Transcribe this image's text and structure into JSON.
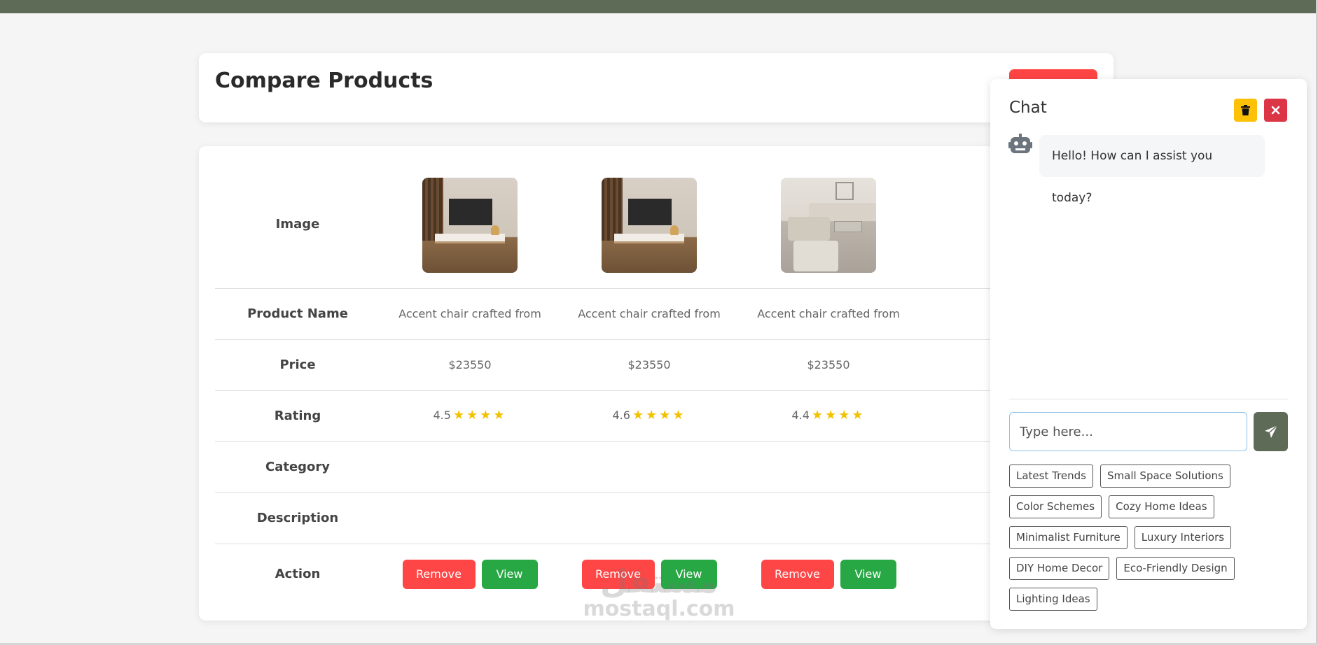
{
  "page": {
    "title": "Compare Products"
  },
  "compare": {
    "row_labels": {
      "image": "Image",
      "name": "Product Name",
      "price": "Price",
      "rating": "Rating",
      "category": "Category",
      "description": "Description",
      "action": "Action"
    },
    "products": [
      {
        "image": "tv-unit-photo",
        "name": "Accent chair crafted from",
        "price": "$23550",
        "rating": "4.5",
        "stars": "★★★★",
        "category": "",
        "description": "",
        "remove_label": "Remove",
        "view_label": "View"
      },
      {
        "image": "tv-unit-photo",
        "name": "Accent chair crafted from",
        "price": "$23550",
        "rating": "4.6",
        "stars": "★★★★",
        "category": "",
        "description": "",
        "remove_label": "Remove",
        "view_label": "View"
      },
      {
        "image": "sofa-living-room-photo",
        "name": "Accent chair crafted from",
        "price": "$23550",
        "rating": "4.4",
        "stars": "★★★★",
        "category": "",
        "description": "",
        "remove_label": "Remove",
        "view_label": "View"
      }
    ]
  },
  "chat": {
    "title": "Chat",
    "trash_icon": "trash-icon",
    "close_icon": "close-icon",
    "bot_icon": "robot-icon",
    "messages": [
      {
        "from": "bot",
        "text": "Hello! How can I assist you today?"
      }
    ],
    "input_placeholder": "Type here...",
    "send_icon": "paper-plane-icon",
    "suggestions": [
      "Latest Trends",
      "Small Space Solutions",
      "Color Schemes",
      "Cozy Home Ideas",
      "Minimalist Furniture",
      "Luxury Interiors",
      "DIY Home Decor",
      "Eco-Friendly Design",
      "Lighting Ideas"
    ]
  },
  "watermark": {
    "arabic": "مستقل",
    "latin": "mostaql.com"
  },
  "colors": {
    "topbar": "#5d6b57",
    "remove": "#ff4646",
    "view": "#28a745",
    "star": "#f2c200",
    "trash_button": "#ffc107",
    "close_button": "#dc3545",
    "send_button": "#5d6b57"
  }
}
